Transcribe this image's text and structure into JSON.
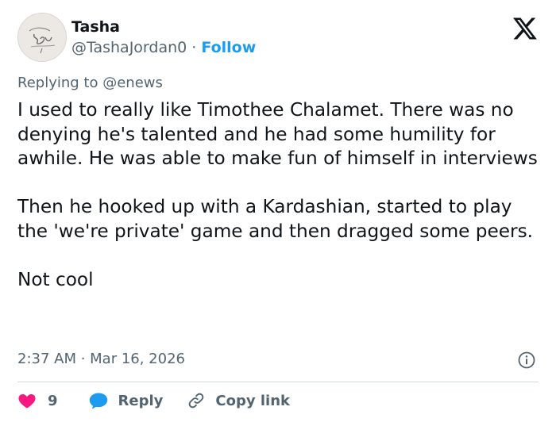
{
  "author": {
    "name": "Tasha",
    "handle": "@TashaJordan0",
    "separator": "·",
    "follow_label": "Follow",
    "avatar_icon": "signature-avatar"
  },
  "reply_context": {
    "prefix": "Replying to",
    "mention": "@enews"
  },
  "tweet": {
    "paragraphs": [
      "I used to really like Timothee Chalamet. There was no denying he's talented and he had some humility for awhile. He was able to make fun of himself in interviews",
      "Then he hooked up with a Kardashian, started to play the 'we're private' game and then dragged some peers.",
      "Not cool"
    ],
    "timestamp": "2:37 AM · Mar 16, 2026"
  },
  "actions": {
    "like_count": "9",
    "reply_label": "Reply",
    "copy_link_label": "Copy link"
  },
  "icons": {
    "brand": "x-logo",
    "info": "info-icon",
    "like": "heart-icon",
    "reply": "speech-bubble-icon",
    "copy": "link-icon"
  },
  "colors": {
    "text": "#0f1419",
    "secondary": "#536471",
    "link": "#1d9bf0",
    "like": "#f91880",
    "divider": "#cfd9de"
  }
}
